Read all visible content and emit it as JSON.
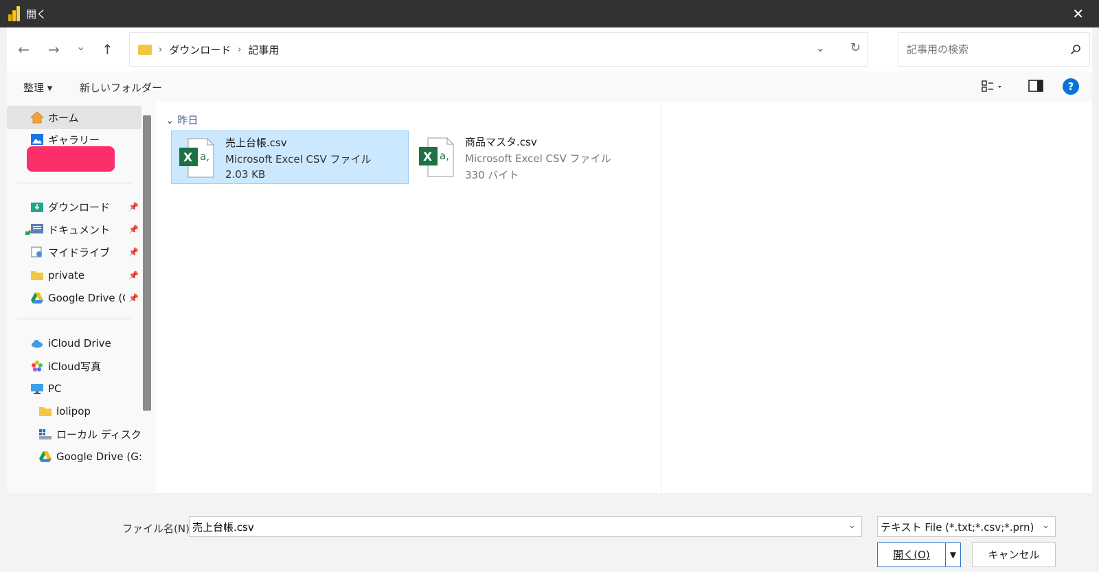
{
  "window": {
    "title": "開く",
    "close_glyph": "✕"
  },
  "nav": {
    "back": "←",
    "forward": "→",
    "recent": "⌄",
    "up": "↑",
    "breadcrumb": [
      "ダウンロード",
      "記事用"
    ],
    "separator": "›",
    "dropdown_glyph": "⌄",
    "refresh_glyph": "↻",
    "search_placeholder": "記事用の検索"
  },
  "command_bar": {
    "organize": "整理 ▾",
    "new_folder": "新しいフォルダー",
    "help": "?"
  },
  "sidebar": {
    "items": [
      {
        "label": "ホーム"
      },
      {
        "label": "ギャラリー"
      },
      {
        "label": "ダウンロード"
      },
      {
        "label": "ドキュメント"
      },
      {
        "label": "マイドライブ"
      },
      {
        "label": "private"
      },
      {
        "label": "Google Drive (G:)"
      },
      {
        "label": "iCloud Drive"
      },
      {
        "label": "iCloud写真"
      },
      {
        "label": "PC"
      },
      {
        "label": "lolipop"
      },
      {
        "label": "ローカル ディスク (C:)"
      },
      {
        "label": "Google Drive (G:)"
      }
    ],
    "pin_glyph": "📌"
  },
  "content": {
    "group_label": "昨日",
    "group_chevron": "⌄",
    "files": [
      {
        "name": "売上台帳.csv",
        "type": "Microsoft Excel CSV ファイル",
        "size": "2.03 KB"
      },
      {
        "name": "商品マスタ.csv",
        "type": "Microsoft Excel CSV ファイル",
        "size": "330 バイト"
      }
    ],
    "icon_letters": {
      "x": "X",
      "a": "a,"
    }
  },
  "bottom": {
    "filename_label": "ファイル名(N):",
    "filename_value": "売上台帳.csv",
    "filetype": "テキスト File (*.txt;*.csv;*.prn)",
    "open_label": "開く(O)",
    "open_arrow": "▼",
    "cancel_label": "キャンセル",
    "chevron": "⌄"
  },
  "colors": {
    "titlebar": "#323232",
    "selection": "#cce8ff",
    "excel_green": "#1e7145",
    "accent": "#0a73d9",
    "redaction": "#fc2f6b"
  }
}
